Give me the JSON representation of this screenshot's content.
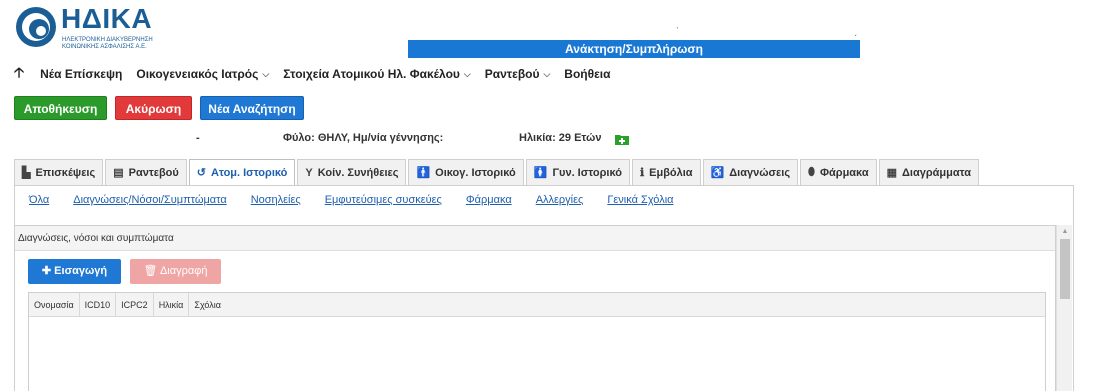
{
  "brand": {
    "name": "ΗΔΙΚΑ",
    "subtitle_line1": "ΗΛΕΚΤΡΟΝΙΚΗ ΔΙΑΚΥΒΕΡΝΗΣΗ",
    "subtitle_line2": "ΚΟΙΝΩΝΙΚΗΣ ΑΣΦΑΛΙΣΗΣ Α.Ε.",
    "color": "#1b5e96"
  },
  "header": {
    "title": "Ανάκτηση/Συμπλήρωση",
    "title_bg": "#1978d4"
  },
  "nav": {
    "items": [
      {
        "label": "Νέα Επίσκεψη",
        "has_caret": false
      },
      {
        "label": "Οικογενειακός Ιατρός",
        "has_caret": true
      },
      {
        "label": "Στοιχεία Ατομικού Ηλ. Φακέλου",
        "has_caret": true
      },
      {
        "label": "Ραντεβού",
        "has_caret": true
      },
      {
        "label": "Βοήθεια",
        "has_caret": false
      }
    ]
  },
  "actions": {
    "save": "Αποθήκευση",
    "cancel": "Ακύρωση",
    "new_search": "Νέα Αναζήτηση"
  },
  "patient": {
    "dash": "-",
    "gender_label": "Φύλο: ΘΗΛΥ,  Ημ/νία γέννησης:",
    "age_label": "Ηλικία: 29 Ετών"
  },
  "tabs": [
    {
      "label": "Επισκέψεις",
      "icon": "visits-icon",
      "glyph": "▙",
      "active": false
    },
    {
      "label": "Ραντεβού",
      "icon": "calendar-icon",
      "glyph": "▤",
      "active": false
    },
    {
      "label": "Ατομ. Ιστορικό",
      "icon": "history-icon",
      "glyph": "↺",
      "active": true
    },
    {
      "label": "Κοίν. Συνήθειες",
      "icon": "glass-icon",
      "glyph": "Y",
      "active": false
    },
    {
      "label": "Οικογ. Ιστορικό",
      "icon": "family-icon",
      "glyph": "🚹",
      "active": false
    },
    {
      "label": "Γυν. Ιστορικό",
      "icon": "female-icon",
      "glyph": "🚺",
      "active": false
    },
    {
      "label": "Εμβόλια",
      "icon": "syringe-icon",
      "glyph": "ℹ",
      "active": false
    },
    {
      "label": "Διαγνώσεις",
      "icon": "wheelchair-icon",
      "glyph": "♿",
      "active": false
    },
    {
      "label": "Φάρμακα",
      "icon": "pill-icon",
      "glyph": "⬮",
      "active": false
    },
    {
      "label": "Διαγράμματα",
      "icon": "chart-icon",
      "glyph": "▦",
      "active": false
    }
  ],
  "subtabs": [
    "Όλα",
    "Διαγνώσεις/Νόσοι/Συμπτώματα",
    "Νοσηλείες",
    "Εμφυτεύσιμες συσκεύες",
    "Φάρμακα",
    "Αλλεργίες",
    "Γενικά Σχόλια"
  ],
  "panel": {
    "heading": "Διαγνώσεις, νόσοι και συμπτώματα",
    "insert": "Εισαγωγή",
    "delete": "Διαγραφή",
    "columns": [
      "Ονομασία",
      "ICD10",
      "ICPC2",
      "Ηλικία",
      "Σχόλια"
    ]
  }
}
